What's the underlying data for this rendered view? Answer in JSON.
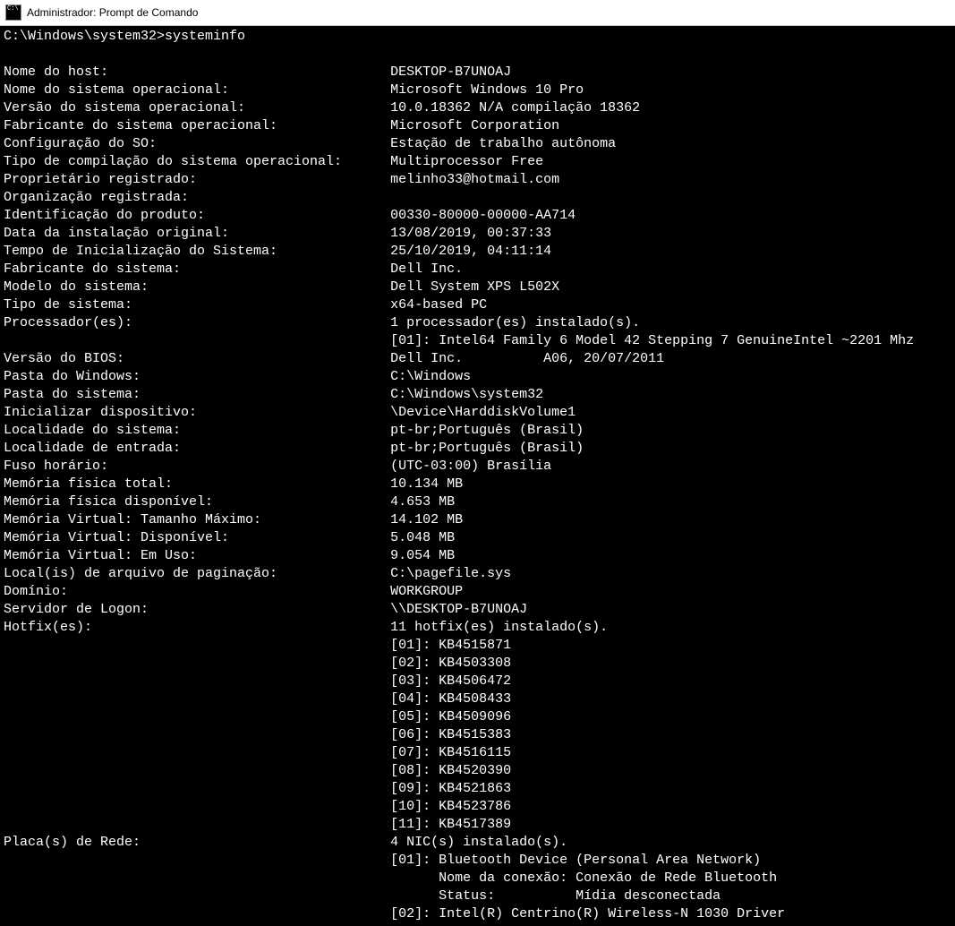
{
  "window": {
    "title": "Administrador: Prompt de Comando"
  },
  "prompt": {
    "path": "C:\\Windows\\system32>",
    "command": "systeminfo"
  },
  "labelWidth": 48,
  "fields": [
    {
      "label": "Nome do host:",
      "value": "DESKTOP-B7UNOAJ"
    },
    {
      "label": "Nome do sistema operacional:",
      "value": "Microsoft Windows 10 Pro"
    },
    {
      "label": "Versão do sistema operacional:",
      "value": "10.0.18362 N/A compilação 18362"
    },
    {
      "label": "Fabricante do sistema operacional:",
      "value": "Microsoft Corporation"
    },
    {
      "label": "Configuração do SO:",
      "value": "Estação de trabalho autônoma"
    },
    {
      "label": "Tipo de compilação do sistema operacional:",
      "value": "Multiprocessor Free"
    },
    {
      "label": "Proprietário registrado:",
      "value": "melinho33@hotmail.com"
    },
    {
      "label": "Organização registrada:",
      "value": ""
    },
    {
      "label": "Identificação do produto:",
      "value": "00330-80000-00000-AA714"
    },
    {
      "label": "Data da instalação original:",
      "value": "13/08/2019, 00:37:33"
    },
    {
      "label": "Tempo de Inicialização do Sistema:",
      "value": "25/10/2019, 04:11:14"
    },
    {
      "label": "Fabricante do sistema:",
      "value": "Dell Inc."
    },
    {
      "label": "Modelo do sistema:",
      "value": "Dell System XPS L502X"
    },
    {
      "label": "Tipo de sistema:",
      "value": "x64-based PC"
    },
    {
      "label": "Processador(es):",
      "value": "1 processador(es) instalado(s)."
    },
    {
      "label": "",
      "value": "[01]: Intel64 Family 6 Model 42 Stepping 7 GenuineIntel ~2201 Mhz"
    },
    {
      "label": "Versão do BIOS:",
      "value": "Dell Inc.          A06, 20/07/2011"
    },
    {
      "label": "Pasta do Windows:",
      "value": "C:\\Windows"
    },
    {
      "label": "Pasta do sistema:",
      "value": "C:\\Windows\\system32"
    },
    {
      "label": "Inicializar dispositivo:",
      "value": "\\Device\\HarddiskVolume1"
    },
    {
      "label": "Localidade do sistema:",
      "value": "pt-br;Português (Brasil)"
    },
    {
      "label": "Localidade de entrada:",
      "value": "pt-br;Português (Brasil)"
    },
    {
      "label": "Fuso horário:",
      "value": "(UTC-03:00) Brasília"
    },
    {
      "label": "Memória física total:",
      "value": "10.134 MB"
    },
    {
      "label": "Memória física disponível:",
      "value": "4.653 MB"
    },
    {
      "label": "Memória Virtual: Tamanho Máximo:",
      "value": "14.102 MB"
    },
    {
      "label": "Memória Virtual: Disponível:",
      "value": "5.048 MB"
    },
    {
      "label": "Memória Virtual: Em Uso:",
      "value": "9.054 MB"
    },
    {
      "label": "Local(is) de arquivo de paginação:",
      "value": "C:\\pagefile.sys"
    },
    {
      "label": "Domínio:",
      "value": "WORKGROUP"
    },
    {
      "label": "Servidor de Logon:",
      "value": "\\\\DESKTOP-B7UNOAJ"
    },
    {
      "label": "Hotfix(es):",
      "value": "11 hotfix(es) instalado(s)."
    },
    {
      "label": "",
      "value": "[01]: KB4515871"
    },
    {
      "label": "",
      "value": "[02]: KB4503308"
    },
    {
      "label": "",
      "value": "[03]: KB4506472"
    },
    {
      "label": "",
      "value": "[04]: KB4508433"
    },
    {
      "label": "",
      "value": "[05]: KB4509096"
    },
    {
      "label": "",
      "value": "[06]: KB4515383"
    },
    {
      "label": "",
      "value": "[07]: KB4516115"
    },
    {
      "label": "",
      "value": "[08]: KB4520390"
    },
    {
      "label": "",
      "value": "[09]: KB4521863"
    },
    {
      "label": "",
      "value": "[10]: KB4523786"
    },
    {
      "label": "",
      "value": "[11]: KB4517389"
    },
    {
      "label": "Placa(s) de Rede:",
      "value": "4 NIC(s) instalado(s)."
    },
    {
      "label": "",
      "value": "[01]: Bluetooth Device (Personal Area Network)"
    },
    {
      "label": "",
      "value": "      Nome da conexão: Conexão de Rede Bluetooth"
    },
    {
      "label": "",
      "value": "      Status:          Mídia desconectada"
    },
    {
      "label": "",
      "value": "[02]: Intel(R) Centrino(R) Wireless-N 1030 Driver"
    }
  ]
}
